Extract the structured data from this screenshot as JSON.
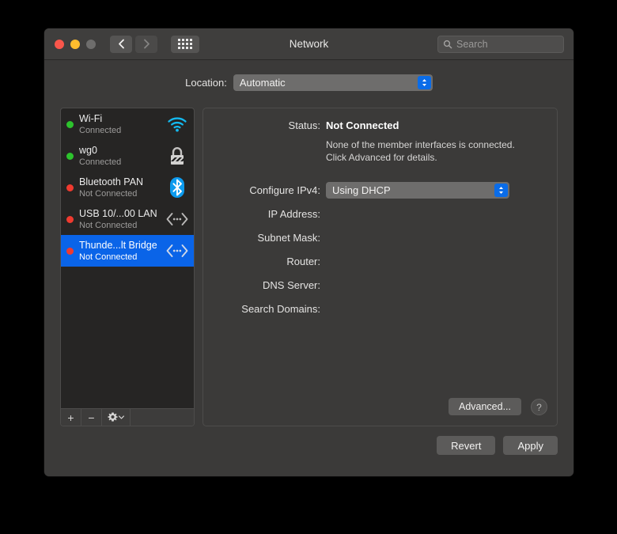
{
  "window": {
    "title": "Network"
  },
  "titlebar": {
    "back_icon": "chevron-left-icon",
    "forward_icon": "chevron-right-icon",
    "grid_icon": "grid-icon",
    "search": {
      "placeholder": "Search",
      "value": "",
      "icon": "search-icon"
    }
  },
  "location": {
    "label": "Location:",
    "value": "Automatic",
    "options": [
      "Automatic"
    ]
  },
  "sidebar": {
    "interfaces": [
      {
        "name": "Wi-Fi",
        "status": "Connected",
        "dot": "green",
        "icon": "wifi-icon",
        "selected": false
      },
      {
        "name": "wg0",
        "status": "Connected",
        "dot": "green",
        "icon": "lock-icon",
        "selected": false
      },
      {
        "name": "Bluetooth PAN",
        "status": "Not Connected",
        "dot": "red",
        "icon": "bluetooth-icon",
        "selected": false
      },
      {
        "name": "USB 10/...00 LAN",
        "status": "Not Connected",
        "dot": "red",
        "icon": "ethernet-icon",
        "selected": false
      },
      {
        "name": "Thunde...lt Bridge",
        "status": "Not Connected",
        "dot": "red",
        "icon": "ethernet-icon",
        "selected": true
      }
    ],
    "toolbar": {
      "add_label": "+",
      "remove_label": "−",
      "gear_icon": "gear-icon",
      "gear_chevron_icon": "chevron-down-icon"
    }
  },
  "detail": {
    "status_label": "Status:",
    "status_value": "Not Connected",
    "status_note_line1": "None of the member interfaces is connected.",
    "status_note_line2": "Click Advanced for details.",
    "configure_label": "Configure IPv4:",
    "configure_value": "Using DHCP",
    "configure_options": [
      "Using DHCP"
    ],
    "ip_address_label": "IP Address:",
    "ip_address_value": "",
    "subnet_mask_label": "Subnet Mask:",
    "subnet_mask_value": "",
    "router_label": "Router:",
    "router_value": "",
    "dns_server_label": "DNS Server:",
    "dns_server_value": "",
    "search_domains_label": "Search Domains:",
    "search_domains_value": "",
    "advanced_label": "Advanced...",
    "help_label": "?"
  },
  "footer": {
    "revert_label": "Revert",
    "apply_label": "Apply"
  },
  "colors": {
    "accent_blue": "#0a64e8",
    "popup_chevron_blue": "#0a6ce8",
    "connected_dot": "#2dc32d",
    "disconnected_dot": "#f03a2f",
    "window_bg": "#3b3a39",
    "sidebar_bg": "#262524"
  }
}
